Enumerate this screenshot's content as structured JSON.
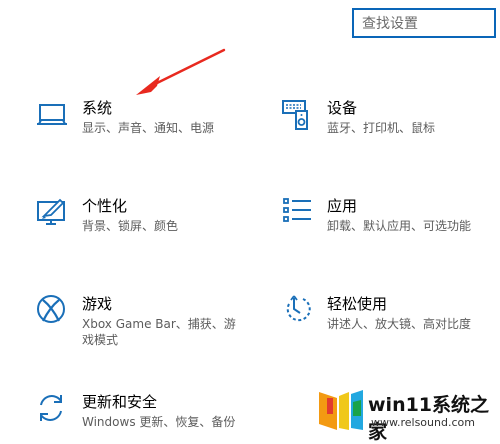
{
  "search": {
    "placeholder": "查找设置"
  },
  "tiles": [
    {
      "title": "系统",
      "desc": "显示、声音、通知、电源",
      "icon": "laptop-icon"
    },
    {
      "title": "设备",
      "desc": "蓝牙、打印机、鼠标",
      "icon": "devices-icon"
    },
    {
      "title": "个性化",
      "desc": "背景、锁屏、颜色",
      "icon": "personalization-icon"
    },
    {
      "title": "应用",
      "desc": "卸载、默认应用、可选功能",
      "icon": "apps-icon"
    },
    {
      "title": "游戏",
      "desc": "Xbox Game Bar、捕获、游戏模式",
      "icon": "xbox-icon"
    },
    {
      "title": "轻松使用",
      "desc": "讲述人、放大镜、高对比度",
      "icon": "ease-of-access-icon"
    },
    {
      "title": "更新和安全",
      "desc": "Windows 更新、恢复、备份",
      "icon": "update-icon"
    }
  ],
  "watermark": {
    "text": "win11系统之家",
    "url": "www.relsound.com"
  },
  "colors": {
    "accent": "#1a6fb8",
    "arrow": "#e8291f"
  }
}
